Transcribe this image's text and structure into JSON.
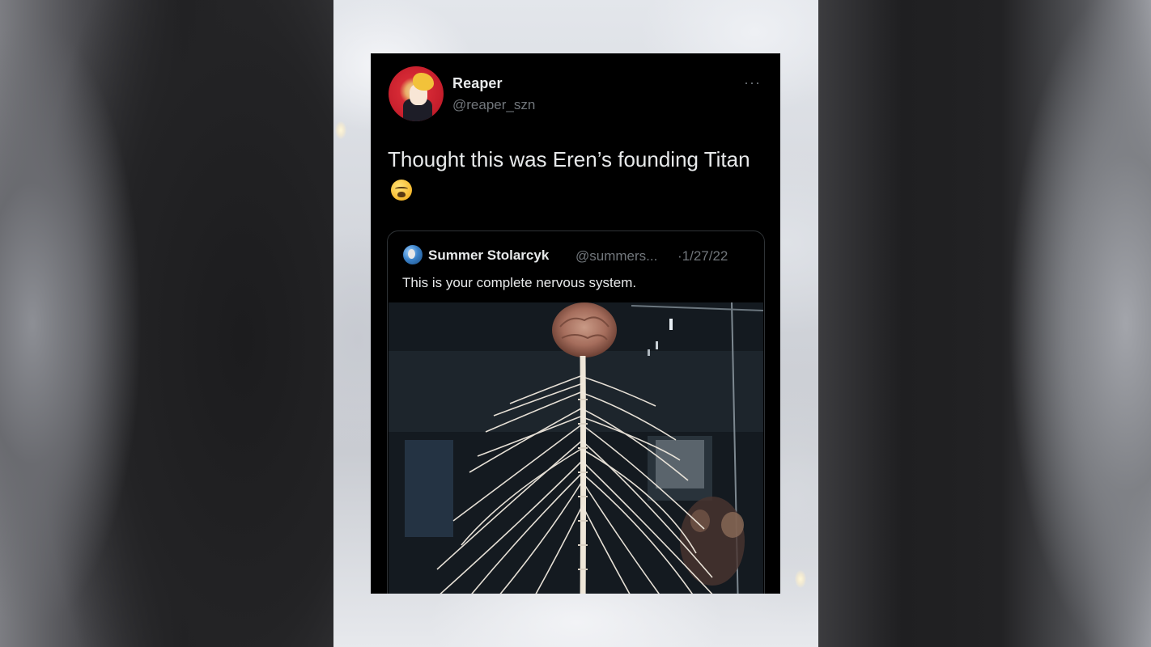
{
  "tweet": {
    "author_name": "Reaper",
    "author_handle": "@reaper_szn",
    "more_label": "···",
    "text": "Thought this was Eren’s founding Titan"
  },
  "quoted_tweet": {
    "author_name": "Summer Stolarcyk",
    "author_handle": "@summers...",
    "date": "·1/27/22",
    "text": "This is your complete nervous system."
  },
  "icons": {
    "avatar": "avatar-image",
    "emoji": "loudly-crying-face-emoji",
    "more": "more-options-icon",
    "quoted_avatar": "globe-avatar-image",
    "media": "nervous-system-photo"
  }
}
